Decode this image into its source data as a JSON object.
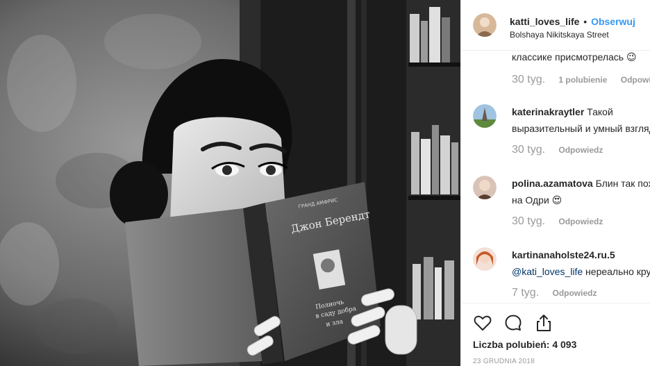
{
  "header": {
    "username": "katti_loves_life",
    "separator": "•",
    "follow_label": "Obserwuj",
    "location": "Bolshaya Nikitskaya Street"
  },
  "comments": [
    {
      "username": "",
      "text": "классике присмотрелась 😉",
      "age": "30 tyg.",
      "likes": "1 polubienie",
      "reply": "Odpowiedz"
    },
    {
      "username": "katerinakraytler",
      "text": " Такой",
      "text2": "выразительный и умный взгляд",
      "age": "30 tyg.",
      "reply": "Odpowiedz"
    },
    {
      "username": "polina.azamatova",
      "text": " Блин так похожа",
      "text2": "на Одри 😍",
      "age": "30 tyg.",
      "reply": "Odpowiedz"
    },
    {
      "username": "kartinanaholste24.ru.5",
      "mention": "@kati_loves_life",
      "text2": " нереально круто",
      "age": "7 tyg.",
      "reply": "Odpowiedz"
    }
  ],
  "actions": {
    "like_icon": "heart-icon",
    "comment_icon": "comment-bubble-icon",
    "share_icon": "share-icon"
  },
  "likes_text": "Liczba polubień: 4 093",
  "date": "23 GRUDNIA 2018",
  "book": {
    "publisher": "ГРАНД  АМФРИС",
    "author": "Джон Берендт",
    "title_line1": "Полночь",
    "title_line2": "в саду добра",
    "title_line3": "и зла"
  },
  "colors": {
    "follow": "#3897f0",
    "text": "#262626",
    "meta": "#999999"
  }
}
